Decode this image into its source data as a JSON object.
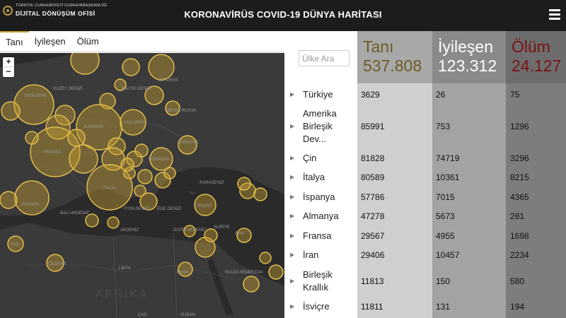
{
  "header": {
    "logo_line1": "TÜRKİYE CUMHURİYETİ CUMHURBAŞKANLIĞI",
    "logo_line2": "DİJİTAL DÖNÜŞÜM OFİSİ",
    "title": "KORONAVİRÜS COVID-19 DÜNYA HARİTASI",
    "menu_icon": "hamburger-icon"
  },
  "tabs": [
    {
      "label": "Tanı",
      "active": true
    },
    {
      "label": "İyileşen",
      "active": false
    },
    {
      "label": "Ölüm",
      "active": false
    }
  ],
  "map": {
    "zoom_in": "+",
    "zoom_out": "−",
    "bubble_color": "#c9a233",
    "labels": [
      "İNGİLTERE",
      "KUZEY DENİZİ",
      "BALTIK DENİZİ",
      "LETONYA",
      "BEYAZ RUSYA",
      "ALMANYA",
      "POLONYA",
      "UKRAYNA",
      "FRANSA",
      "ROMANYA",
      "İTALYA",
      "İSPANYA",
      "TÜRKİYE",
      "KARADENİZ",
      "BALİ AKDENİZ",
      "İYON DENİZİ",
      "EGE DENİZİ",
      "AKDENİZ",
      "DOĞU AKDENİZ",
      "SURİYE",
      "IRAK",
      "LİBYA",
      "MISIR",
      "SUUDİ ARABİSTAN",
      "CEZAYİR",
      "AFRİKA",
      "FAS",
      "ÇAD",
      "SUDAN"
    ]
  },
  "search": {
    "placeholder": "Ülke Ara"
  },
  "summary": {
    "tani_label": "Tanı",
    "tani_value": "537.808",
    "iyilesen_label": "İyileşen",
    "iyilesen_value": "123.312",
    "olum_label": "Ölüm",
    "olum_value": "24.127"
  },
  "countries": [
    {
      "name": "Türkiye",
      "tani": "3629",
      "iyilesen": "26",
      "olum": "75"
    },
    {
      "name": "Amerika Birleşik Dev...",
      "tani": "85991",
      "iyilesen": "753",
      "olum": "1296"
    },
    {
      "name": "Çin",
      "tani": "81828",
      "iyilesen": "74719",
      "olum": "3296"
    },
    {
      "name": "İtalya",
      "tani": "80589",
      "iyilesen": "10361",
      "olum": "8215"
    },
    {
      "name": "İspanya",
      "tani": "57786",
      "iyilesen": "7015",
      "olum": "4365"
    },
    {
      "name": "Almanya",
      "tani": "47278",
      "iyilesen": "5673",
      "olum": "281"
    },
    {
      "name": "Fransa",
      "tani": "29567",
      "iyilesen": "4955",
      "olum": "1698"
    },
    {
      "name": "İran",
      "tani": "29406",
      "iyilesen": "10457",
      "olum": "2234"
    },
    {
      "name": "Birleşik Krallık",
      "tani": "11813",
      "iyilesen": "150",
      "olum": "580"
    },
    {
      "name": "İsviçre",
      "tani": "11811",
      "iyilesen": "131",
      "olum": "194"
    }
  ]
}
